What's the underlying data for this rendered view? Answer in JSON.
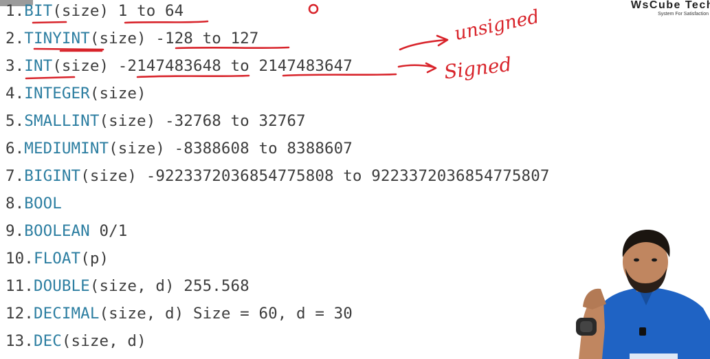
{
  "brand": {
    "name": "WsCube Tech",
    "tagline": "System For Satisfaction"
  },
  "rows": [
    {
      "num": "1.",
      "keyword": "BIT",
      "rest": "(size) 1 to 64"
    },
    {
      "num": "2.",
      "keyword": "TINYINT",
      "rest": "(size) -128 to 127"
    },
    {
      "num": "3.",
      "keyword": "INT",
      "rest": "(size) -2147483648 to 2147483647"
    },
    {
      "num": "4.",
      "keyword": "INTEGER",
      "rest": "(size)"
    },
    {
      "num": "5.",
      "keyword": "SMALLINT",
      "rest": "(size) -32768 to 32767"
    },
    {
      "num": "6.",
      "keyword": "MEDIUMINT",
      "rest": "(size) -8388608 to 8388607"
    },
    {
      "num": "7.",
      "keyword": "BIGINT",
      "rest": "(size) -9223372036854775808 to 9223372036854775807"
    },
    {
      "num": "8.",
      "keyword": "BOOL",
      "rest": ""
    },
    {
      "num": "9.",
      "keyword": "BOOLEAN",
      "rest": " 0/1"
    },
    {
      "num": "10.",
      "keyword": "FLOAT",
      "rest": "(p)"
    },
    {
      "num": "11.",
      "keyword": "DOUBLE",
      "rest": "(size, d) 255.568"
    },
    {
      "num": "12.",
      "keyword": "DECIMAL",
      "rest": "(size, d) Size = 60, d = 30"
    },
    {
      "num": "13.",
      "keyword": "DEC",
      "rest": "(size, d)"
    }
  ],
  "annotations": {
    "unsigned": "unsigned",
    "signed": "Signed"
  },
  "colors": {
    "keyword": "#2c7ea1",
    "text": "#3d3d3d",
    "ink": "#d8232a",
    "shirt": "#1f63c4"
  }
}
